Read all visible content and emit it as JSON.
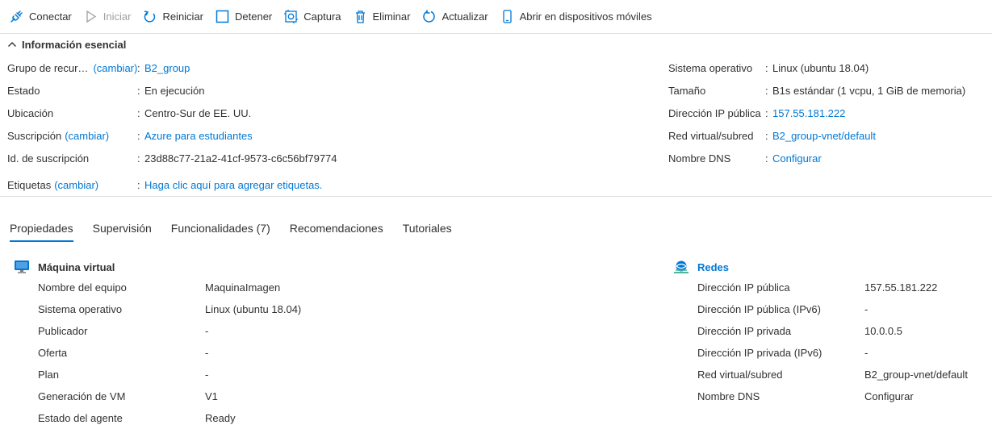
{
  "toolbar": {
    "connect": "Conectar",
    "start": "Iniciar",
    "restart": "Reiniciar",
    "stop": "Detener",
    "capture": "Captura",
    "delete": "Eliminar",
    "refresh": "Actualizar",
    "mobile": "Abrir en dispositivos móviles"
  },
  "essentials": {
    "title": "Información esencial",
    "resource_group": {
      "label": "Grupo de recur…",
      "change": "(cambiar)",
      "value": "B2_group"
    },
    "status": {
      "label": "Estado",
      "value": "En ejecución"
    },
    "location": {
      "label": "Ubicación",
      "value": "Centro-Sur de EE. UU."
    },
    "subscription": {
      "label": "Suscripción",
      "change": "(cambiar)",
      "value": "Azure para estudiantes"
    },
    "subscription_id": {
      "label": "Id. de suscripción",
      "value": "23d88c77-21a2-41cf-9573-c6c56bf79774"
    },
    "tags": {
      "label": "Etiquetas",
      "change": "(cambiar)",
      "value": "Haga clic aquí para agregar etiquetas."
    },
    "os": {
      "label": "Sistema operativo",
      "value": "Linux (ubuntu 18.04)"
    },
    "size": {
      "label": "Tamaño",
      "value": "B1s estándar (1 vcpu, 1 GiB de memoria)"
    },
    "public_ip": {
      "label": "Dirección IP pública",
      "value": "157.55.181.222"
    },
    "vnet": {
      "label": "Red virtual/subred",
      "value": "B2_group-vnet/default"
    },
    "dns": {
      "label": "Nombre DNS",
      "value": "Configurar"
    },
    "separator": ":"
  },
  "tabs": [
    "Propiedades",
    "Supervisión",
    "Funcionalidades (7)",
    "Recomendaciones",
    "Tutoriales"
  ],
  "vm_section": {
    "title": "Máquina virtual",
    "rows": [
      {
        "label": "Nombre del equipo",
        "value": "MaquinaImagen"
      },
      {
        "label": "Sistema operativo",
        "value": "Linux (ubuntu 18.04)"
      },
      {
        "label": "Publicador",
        "value": "-"
      },
      {
        "label": "Oferta",
        "value": "-"
      },
      {
        "label": "Plan",
        "value": "-"
      },
      {
        "label": "Generación de VM",
        "value": "V1"
      },
      {
        "label": "Estado del agente",
        "value": "Ready"
      }
    ]
  },
  "network_section": {
    "title": "Redes",
    "rows": [
      {
        "label": "Dirección IP pública",
        "value": "157.55.181.222"
      },
      {
        "label": "Dirección IP pública (IPv6)",
        "value": "-"
      },
      {
        "label": "Dirección IP privada",
        "value": "10.0.0.5"
      },
      {
        "label": "Dirección IP privada (IPv6)",
        "value": "-"
      },
      {
        "label": "Red virtual/subred",
        "value": "B2_group-vnet/default"
      },
      {
        "label": "Nombre DNS",
        "value": "Configurar"
      }
    ]
  },
  "colors": {
    "accent": "#0078d4",
    "text": "#323130",
    "disabled": "#a19f9d",
    "divider": "#e1dfdd"
  }
}
